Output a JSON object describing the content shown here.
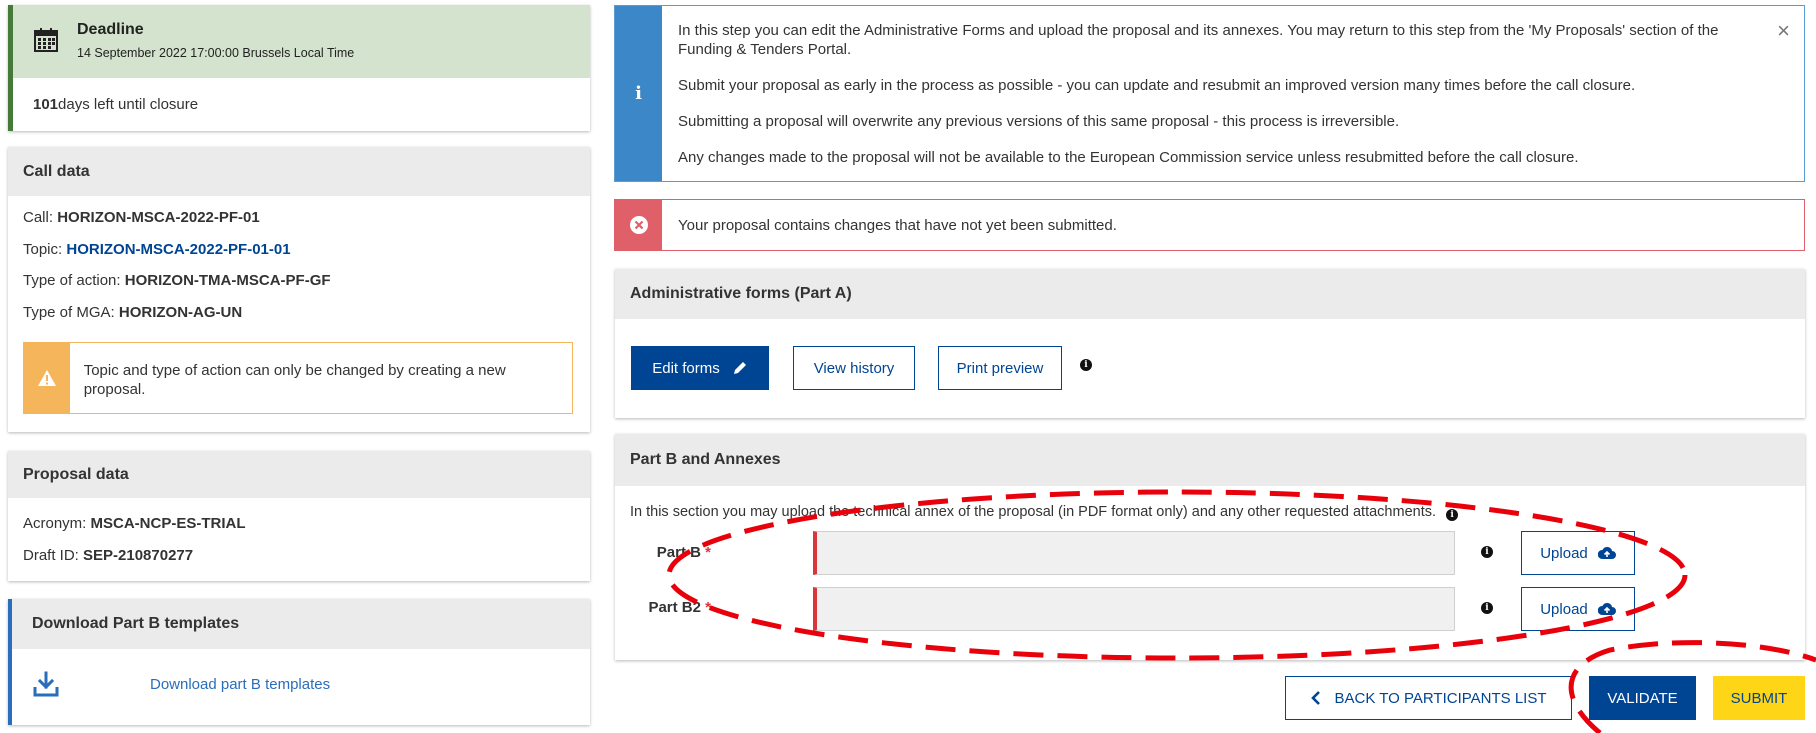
{
  "deadline": {
    "title": "Deadline",
    "date": "14 September 2022 17:00:00 Brussels Local Time",
    "days_left": "101",
    "days_left_suffix": " days left until closure",
    "calendar_icon": "calendar-icon"
  },
  "call_data": {
    "heading": "Call data",
    "call_label": "Call: ",
    "call_value": "HORIZON-MSCA-2022-PF-01",
    "topic_label": "Topic: ",
    "topic_value": "HORIZON-MSCA-2022-PF-01-01",
    "action_label": "Type of action: ",
    "action_value": "HORIZON-TMA-MSCA-PF-GF",
    "mga_label": "Type of MGA: ",
    "mga_value": "HORIZON-AG-UN",
    "warning": "Topic and type of action can only be changed by creating a new proposal.",
    "warning_icon": "warning-triangle-icon"
  },
  "proposal_data": {
    "heading": "Proposal data",
    "acronym_label": "Acronym: ",
    "acronym_value": "MSCA-NCP-ES-TRIAL",
    "draft_label": "Draft ID: ",
    "draft_value": "SEP-210870277"
  },
  "templates": {
    "heading": "Download Part B templates",
    "link": "Download part B templates",
    "icon": "download-icon"
  },
  "info": {
    "icon": "info-icon",
    "paragraphs": [
      "In this step you can edit the Administrative Forms and upload the proposal and its annexes. You may return to this step from the 'My Proposals' section of the Funding & Tenders Portal.",
      "Submit your proposal as early in the process as possible - you can update and resubmit an improved version many times before the call closure.",
      "Submitting a proposal will overwrite any previous versions of this same proposal - this process is irreversible.",
      "Any changes made to the proposal will not be available to the European Commission service unless resubmitted before the call closure."
    ],
    "close": "×"
  },
  "error": {
    "icon": "error-x-icon",
    "text": "Your proposal contains changes that have not yet been submitted."
  },
  "admin_forms": {
    "heading": "Administrative forms (Part A)",
    "edit": "Edit forms",
    "history": "View history",
    "print": "Print preview"
  },
  "part_b": {
    "heading": "Part B and Annexes",
    "description": "In this section you may upload the technical annex of the proposal (in PDF format only) and any other requested attachments.",
    "rows": [
      {
        "label": "Part B",
        "required": "*",
        "upload": "Upload"
      },
      {
        "label": "Part B2",
        "required": "*",
        "upload": "Upload"
      }
    ]
  },
  "footer": {
    "back": "BACK TO PARTICIPANTS LIST",
    "validate": "VALIDATE",
    "submit": "SUBMIT"
  },
  "colors": {
    "primary": "#004494",
    "submit": "#ffd617",
    "deadline_green": "#467a39",
    "info_blue": "#3b87c8",
    "error_red": "#e0606a",
    "warning_orange": "#f5b55b",
    "annotation_red": "#e8000b"
  }
}
